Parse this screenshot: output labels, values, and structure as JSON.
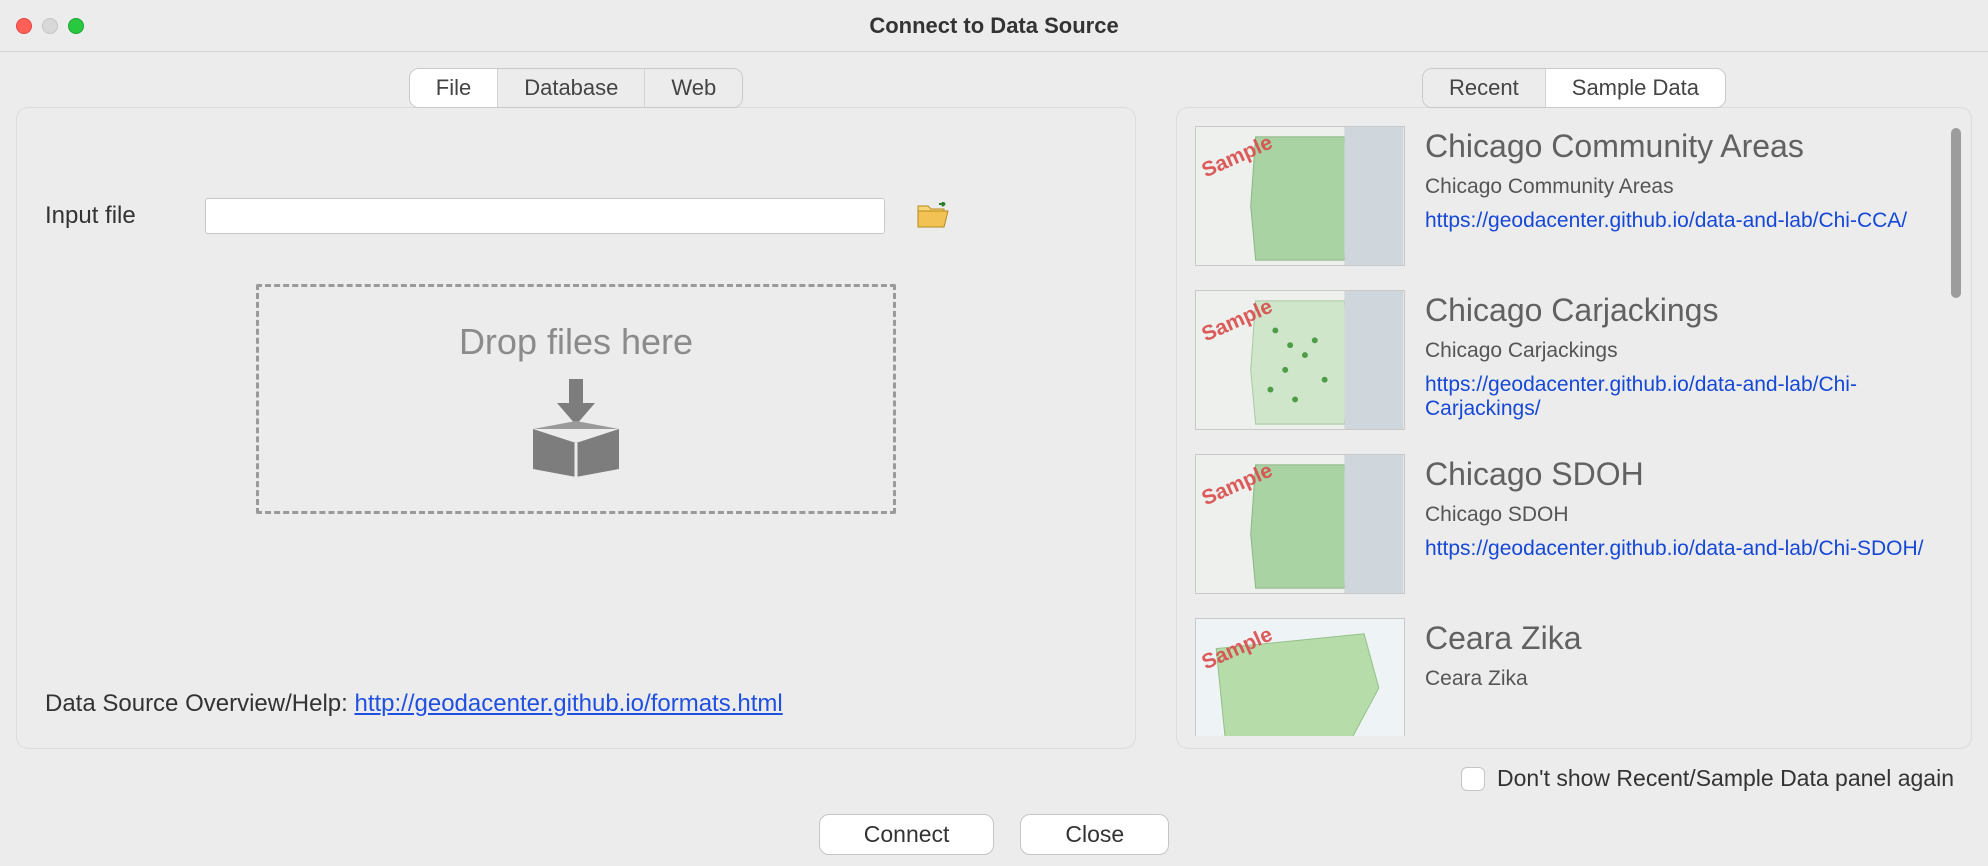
{
  "window": {
    "title": "Connect to Data Source"
  },
  "leftTabs": {
    "items": [
      {
        "label": "File",
        "active": true
      },
      {
        "label": "Database",
        "active": false
      },
      {
        "label": "Web",
        "active": false
      }
    ]
  },
  "inputFile": {
    "label": "Input file",
    "value": ""
  },
  "dropZone": {
    "text": "Drop files here"
  },
  "help": {
    "label": "Data Source Overview/Help:  ",
    "url": "http://geodacenter.github.io/formats.html"
  },
  "rightTabs": {
    "items": [
      {
        "label": "Recent",
        "active": false
      },
      {
        "label": "Sample Data",
        "active": true
      }
    ]
  },
  "watermark": "Sample",
  "samples": [
    {
      "title": "Chicago Community Areas",
      "subtitle": "Chicago Community Areas",
      "link": "https://geodacenter.github.io/data-and-lab/Chi-CCA/"
    },
    {
      "title": "Chicago Carjackings",
      "subtitle": "Chicago Carjackings",
      "link": "https://geodacenter.github.io/data-and-lab/Chi-Carjackings/"
    },
    {
      "title": "Chicago SDOH",
      "subtitle": "Chicago SDOH",
      "link": "https://geodacenter.github.io/data-and-lab/Chi-SDOH/"
    },
    {
      "title": "Ceara Zika",
      "subtitle": "Ceara Zika",
      "link": ""
    }
  ],
  "checkbox": {
    "label": "Don't show Recent/Sample Data panel again",
    "checked": false
  },
  "buttons": {
    "connect": "Connect",
    "close": "Close"
  }
}
